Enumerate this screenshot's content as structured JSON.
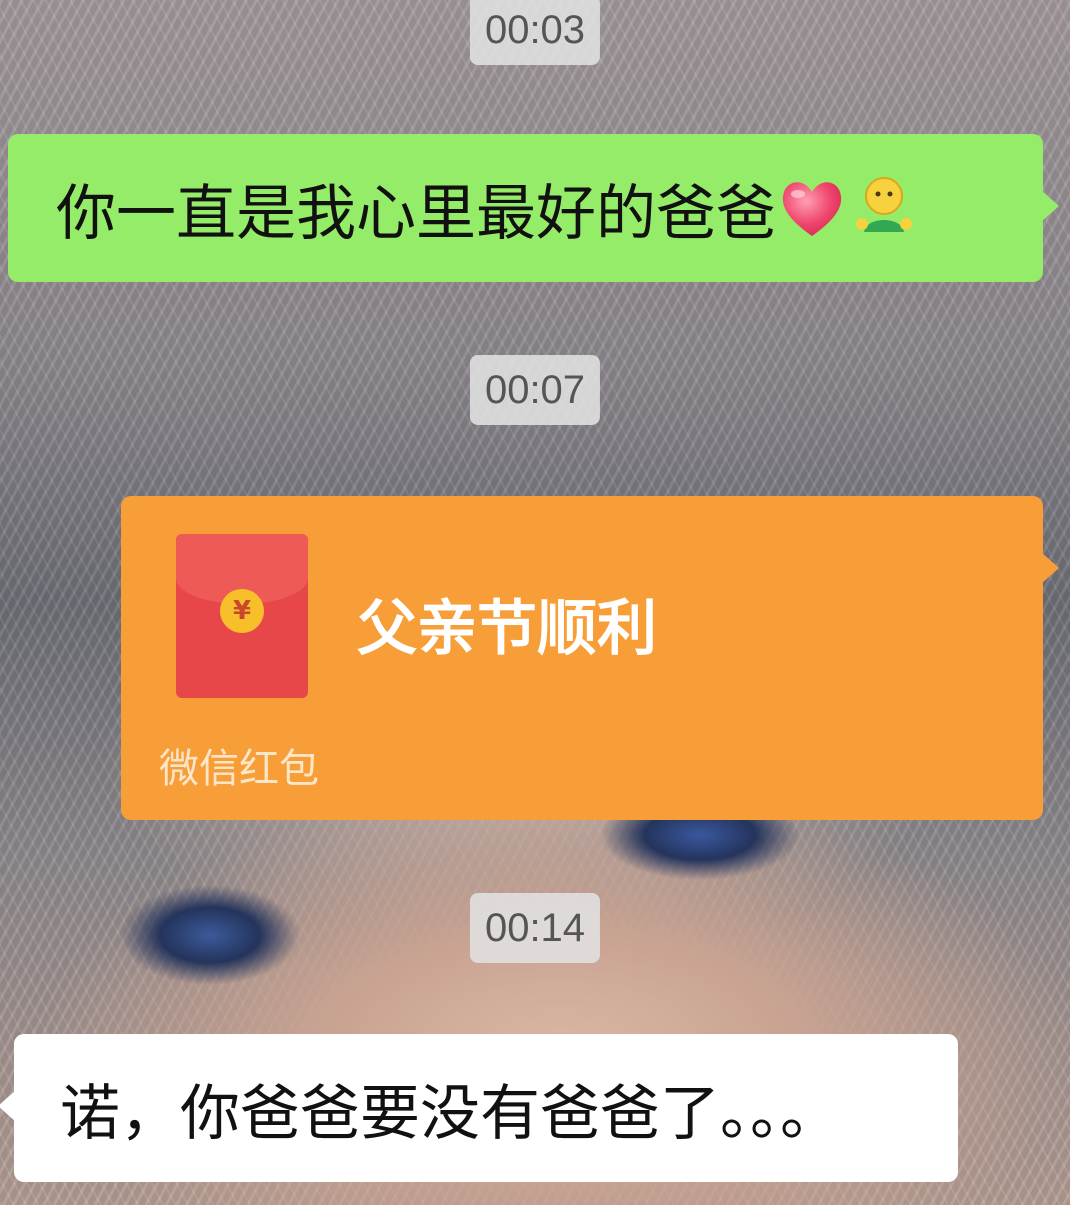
{
  "timestamps": [
    "00:03",
    "00:07",
    "00:14"
  ],
  "messages": {
    "sent_text": "你一直是我心里最好的爸爸",
    "sent_emojis": [
      "heart-emoji",
      "hug-emoji"
    ],
    "red_packet": {
      "title": "父亲节顺利",
      "label": "微信红包",
      "coin_symbol": "¥"
    },
    "received_text": "诺，你爸爸要没有爸爸了。。。"
  },
  "colors": {
    "sent_bubble": "#95ec69",
    "red_packet_bubble": "#f89e38",
    "received_bubble": "#ffffff"
  }
}
